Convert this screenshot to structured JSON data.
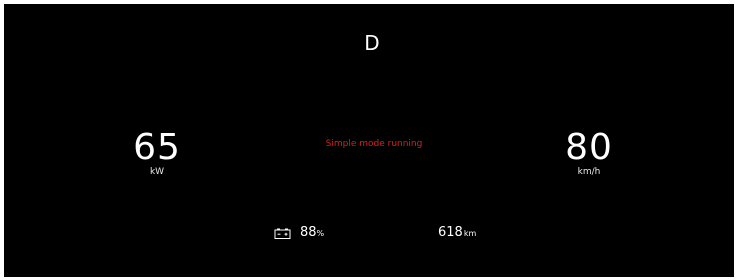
{
  "dashboard": {
    "gear": "D",
    "power": {
      "value": "65",
      "unit": "kW"
    },
    "speed": {
      "value": "80",
      "unit": "km/h"
    },
    "mode_message": "Simple mode running",
    "battery": {
      "icon": "battery-icon",
      "percent": "88",
      "percent_unit": "%"
    },
    "range": {
      "value": "618",
      "unit": "km"
    }
  },
  "colors": {
    "background": "#000000",
    "text": "#ffffff",
    "warning": "#d62020"
  }
}
